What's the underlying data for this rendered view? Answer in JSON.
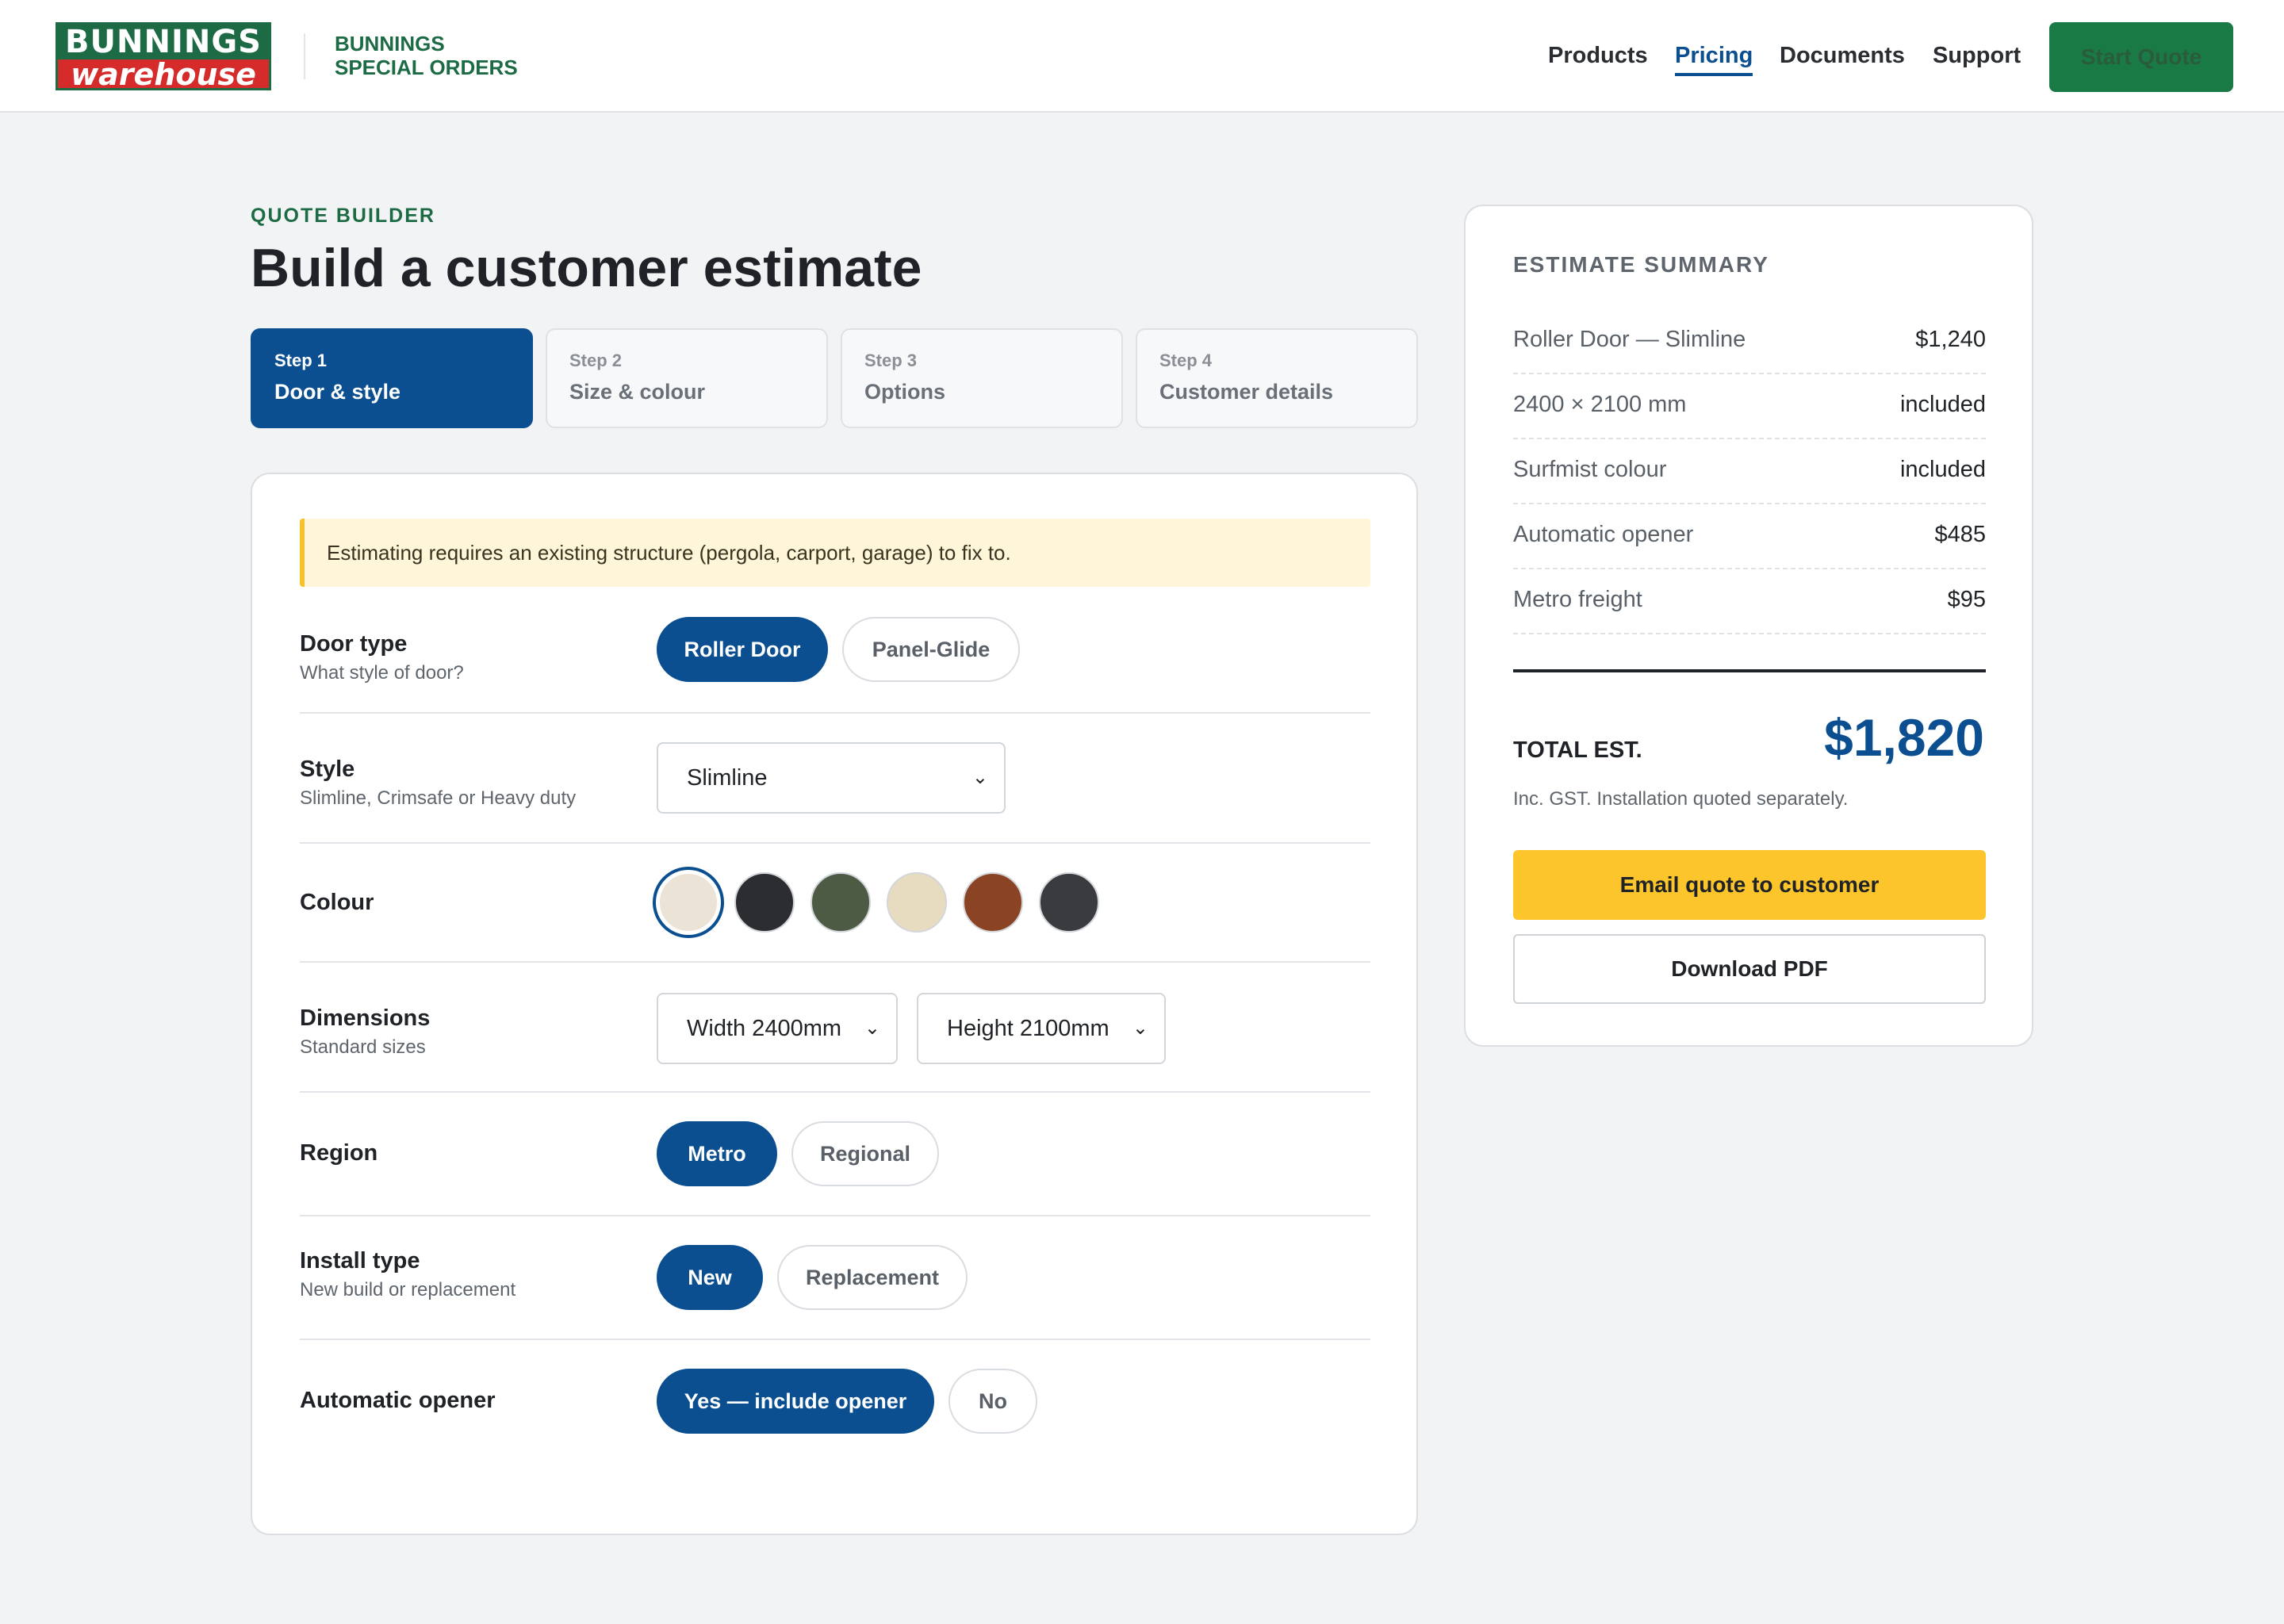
{
  "header": {
    "logo_top": "BUNNINGS",
    "logo_bottom": "warehouse",
    "brand_line1": "BUNNINGS",
    "brand_line2": "SPECIAL ORDERS",
    "nav": [
      "Products",
      "Pricing",
      "Documents",
      "Support"
    ],
    "active_nav": "Pricing",
    "cta": "Start Quote"
  },
  "page": {
    "eyebrow": "QUOTE BUILDER",
    "title": "Build a customer estimate"
  },
  "steps": [
    {
      "num": "Step 1",
      "name": "Door & style",
      "active": true
    },
    {
      "num": "Step 2",
      "name": "Size & colour",
      "active": false
    },
    {
      "num": "Step 3",
      "name": "Options",
      "active": false
    },
    {
      "num": "Step 4",
      "name": "Customer details",
      "active": false
    }
  ],
  "form": {
    "notice": "Estimating requires an existing structure (pergola, carport, garage) to fix to.",
    "door_type": {
      "label": "Door type",
      "hint": "What style of door?",
      "options": [
        "Roller Door",
        "Panel-Glide"
      ],
      "selected": "Roller Door"
    },
    "style": {
      "label": "Style",
      "hint": "Slimline, Crimsafe or Heavy duty",
      "value": "Slimline"
    },
    "colour": {
      "label": "Colour",
      "swatches": [
        "#ebe3d6",
        "#2b2d31",
        "#4d5a44",
        "#e8dcc0",
        "#8a4424",
        "#3a3b3e"
      ],
      "selected_index": 0
    },
    "dimensions": {
      "label": "Dimensions",
      "hint": "Standard sizes",
      "width": "Width 2400mm",
      "height": "Height 2100mm"
    },
    "region": {
      "label": "Region",
      "options": [
        "Metro",
        "Regional"
      ],
      "selected": "Metro"
    },
    "install_type": {
      "label": "Install type",
      "hint": "New build or replacement",
      "options": [
        "New",
        "Replacement"
      ],
      "selected": "New"
    },
    "opener": {
      "label": "Automatic opener",
      "options": [
        "Yes — include opener",
        "No"
      ],
      "selected": "Yes — include opener"
    }
  },
  "summary": {
    "title": "ESTIMATE SUMMARY",
    "lines": [
      {
        "item": "Roller Door — Slimline",
        "amount": "$1,240"
      },
      {
        "item": "2400 × 2100 mm",
        "amount": "included"
      },
      {
        "item": "Surfmist colour",
        "amount": "included"
      },
      {
        "item": "Automatic opener",
        "amount": "$485"
      },
      {
        "item": "Metro freight",
        "amount": "$95"
      }
    ],
    "total_label": "TOTAL EST.",
    "total_value": "$1,820",
    "gst_note": "Inc. GST. Installation quoted separately.",
    "email_button": "Email quote to customer",
    "pdf_button": "Download PDF"
  },
  "colors": {
    "primary": "#0b4f91",
    "brand_green": "#1d6b45",
    "accent_yellow": "#fcc52b",
    "notice_bg": "#fff5d8"
  }
}
